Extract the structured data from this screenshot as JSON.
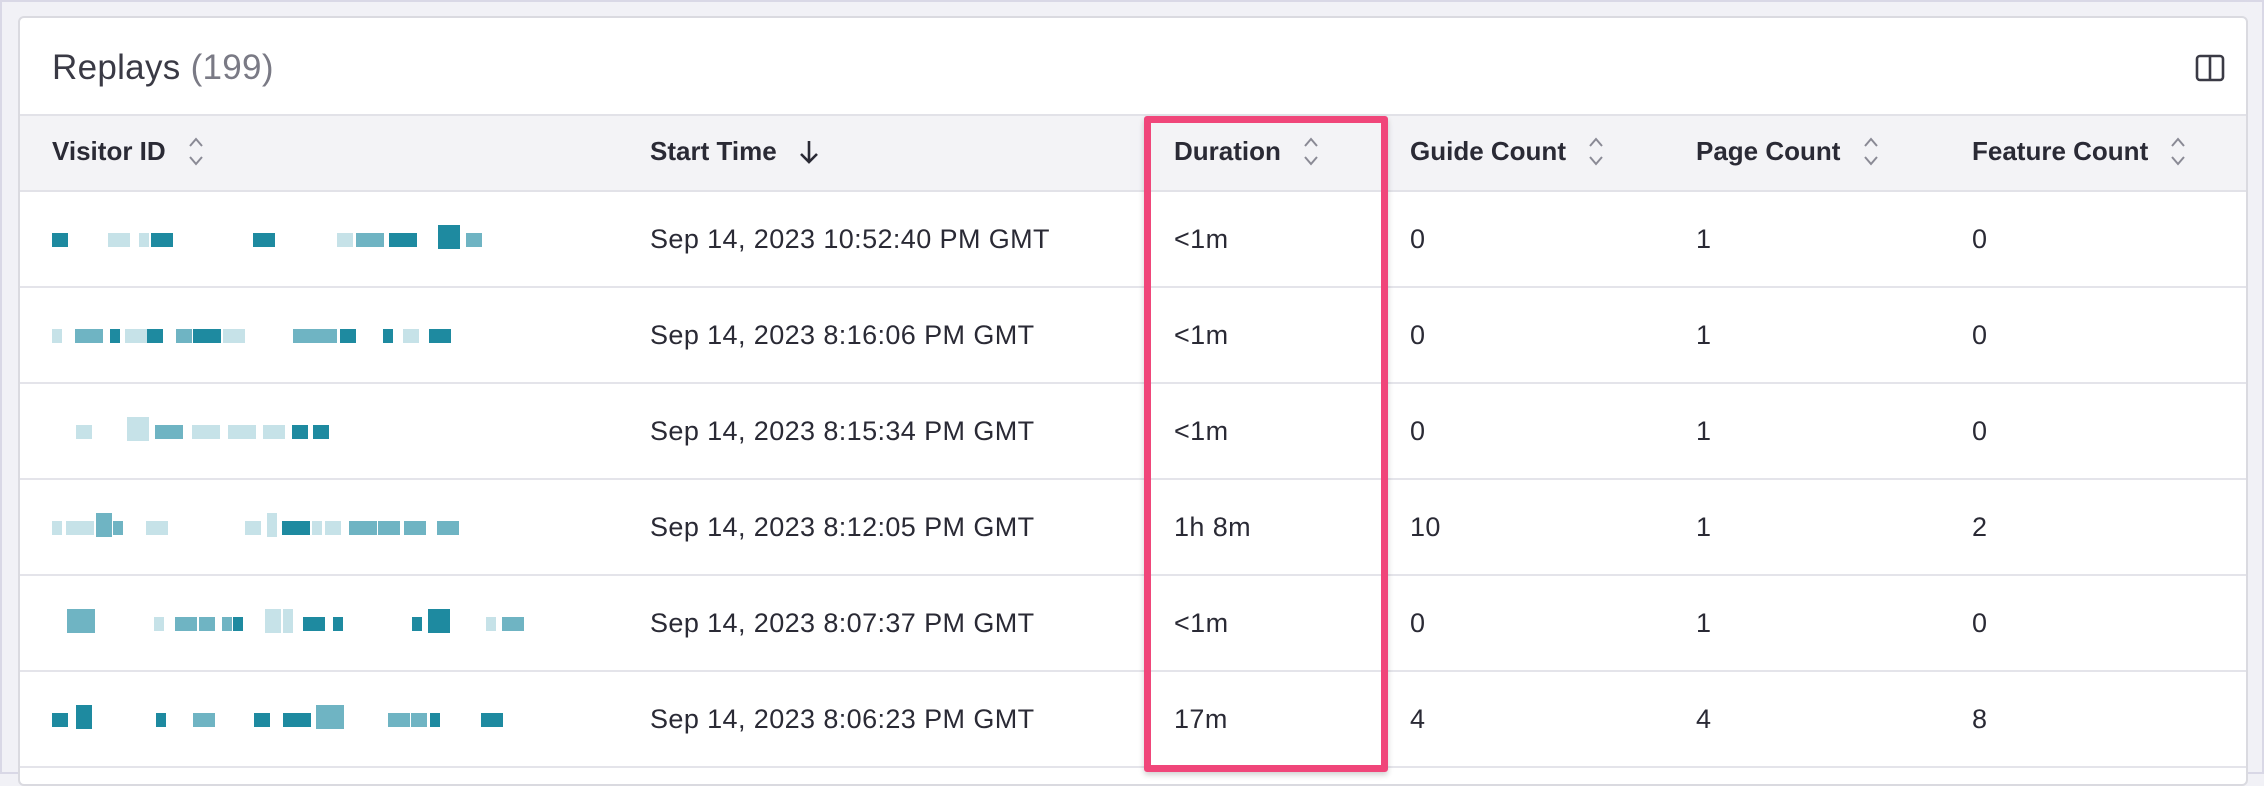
{
  "header": {
    "title": "Replays",
    "count": "(199)",
    "panel_icon": "columns-panel-icon"
  },
  "table": {
    "columns": [
      {
        "label": "Visitor ID",
        "sort": "both"
      },
      {
        "label": "Start Time",
        "sort": "desc"
      },
      {
        "label": "Duration",
        "sort": "both"
      },
      {
        "label": "Guide Count",
        "sort": "both"
      },
      {
        "label": "Page Count",
        "sort": "both"
      },
      {
        "label": "Feature Count",
        "sort": "both"
      }
    ],
    "rows": [
      {
        "start": "Sep 14, 2023 10:52:40 PM GMT",
        "duration": "<1m",
        "guide": "0",
        "page": "1",
        "feature": "0"
      },
      {
        "start": "Sep 14, 2023 8:16:06 PM GMT",
        "duration": "<1m",
        "guide": "0",
        "page": "1",
        "feature": "0"
      },
      {
        "start": "Sep 14, 2023 8:15:34 PM GMT",
        "duration": "<1m",
        "guide": "0",
        "page": "1",
        "feature": "0"
      },
      {
        "start": "Sep 14, 2023 8:12:05 PM GMT",
        "duration": "1h 8m",
        "guide": "10",
        "page": "1",
        "feature": "2"
      },
      {
        "start": "Sep 14, 2023 8:07:37 PM GMT",
        "duration": "<1m",
        "guide": "0",
        "page": "1",
        "feature": "0"
      },
      {
        "start": "Sep 14, 2023 8:06:23 PM GMT",
        "duration": "17m",
        "guide": "4",
        "page": "4",
        "feature": "8"
      }
    ]
  },
  "colors": {
    "highlight": "#f0467a",
    "pixel_dark": "#1e8aa0",
    "pixel_mid": "#6fb4c3",
    "pixel_light": "#c6e2e8"
  }
}
